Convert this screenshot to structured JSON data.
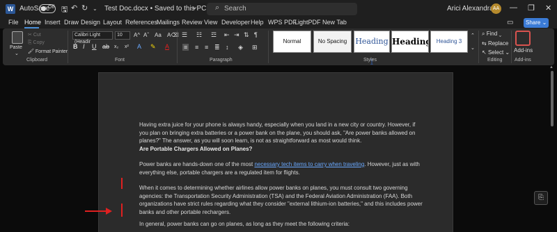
{
  "titlebar": {
    "autosave_label": "AutoSave",
    "autosave_state": "Off",
    "doc_title": "Test Doc.docx • Saved to this PC",
    "doc_title_chevron": "⌄",
    "search_placeholder": "Search",
    "user_name": "Arici Alexandra",
    "user_initials": "AA"
  },
  "menu": {
    "tabs": [
      "File",
      "Home",
      "Insert",
      "Draw",
      "Design",
      "Layout",
      "References",
      "Mailings",
      "Review",
      "View",
      "Developer",
      "Help",
      "WPS PDF",
      "LightPDF",
      "New Tab"
    ],
    "active_tab": "Home",
    "share_label": "Share"
  },
  "ribbon": {
    "clipboard": {
      "paste": "Paste",
      "cut": "Cut",
      "copy": "Copy",
      "format_painter": "Format Painter",
      "group_label": "Clipboard"
    },
    "font": {
      "font_name": "Calibri Light (Headir",
      "font_size": "10",
      "group_label": "Font"
    },
    "paragraph": {
      "group_label": "Paragraph"
    },
    "styles": {
      "items": [
        "Normal",
        "No Spacing",
        "Heading 1",
        "Heading",
        "Heading 3"
      ],
      "group_label": "Styles"
    },
    "editing": {
      "find": "Find",
      "replace": "Replace",
      "select": "Select",
      "group_label": "Editing"
    },
    "addins": {
      "label": "Add-ins",
      "group_label": "Add-ins"
    }
  },
  "document": {
    "p1": "Having extra juice for your phone is always handy, especially when you land in a new city or country. However, if you plan on bringing extra batteries or a power bank on the plane, you should ask, \"Are power banks allowed on planes?\" The answer, as you will soon learn, is not as straightforward as most would think.",
    "h1": "Are Portable Chargers Allowed on Planes?",
    "p2_before": "Power banks are hands-down one of the most ",
    "p2_link": "necessary tech items to carry when traveling",
    "p2_after": ". However, just as with everything else, portable chargers are a regulated item for flights.",
    "p3": "When it comes to determining whether airlines allow power banks on planes, you must consult two governing agencies: the Transportation Security Administration (TSA) and the Federal Aviation Administration (FAA). Both organizations have strict rules regarding what they consider \"external lithium-ion batteries,\" and this includes power banks and other portable rechargers.",
    "p4": "In general, power banks can go on planes, as long as they meet the following criteria:"
  },
  "colors": {
    "accent": "#3b7bd6",
    "link": "#6aa9ff",
    "annotation": "#e02020"
  },
  "icons": {
    "save": "save-icon",
    "undo": "undo-icon",
    "redo": "redo-icon",
    "search": "search-icon",
    "bookmark": "bookmark-icon"
  }
}
